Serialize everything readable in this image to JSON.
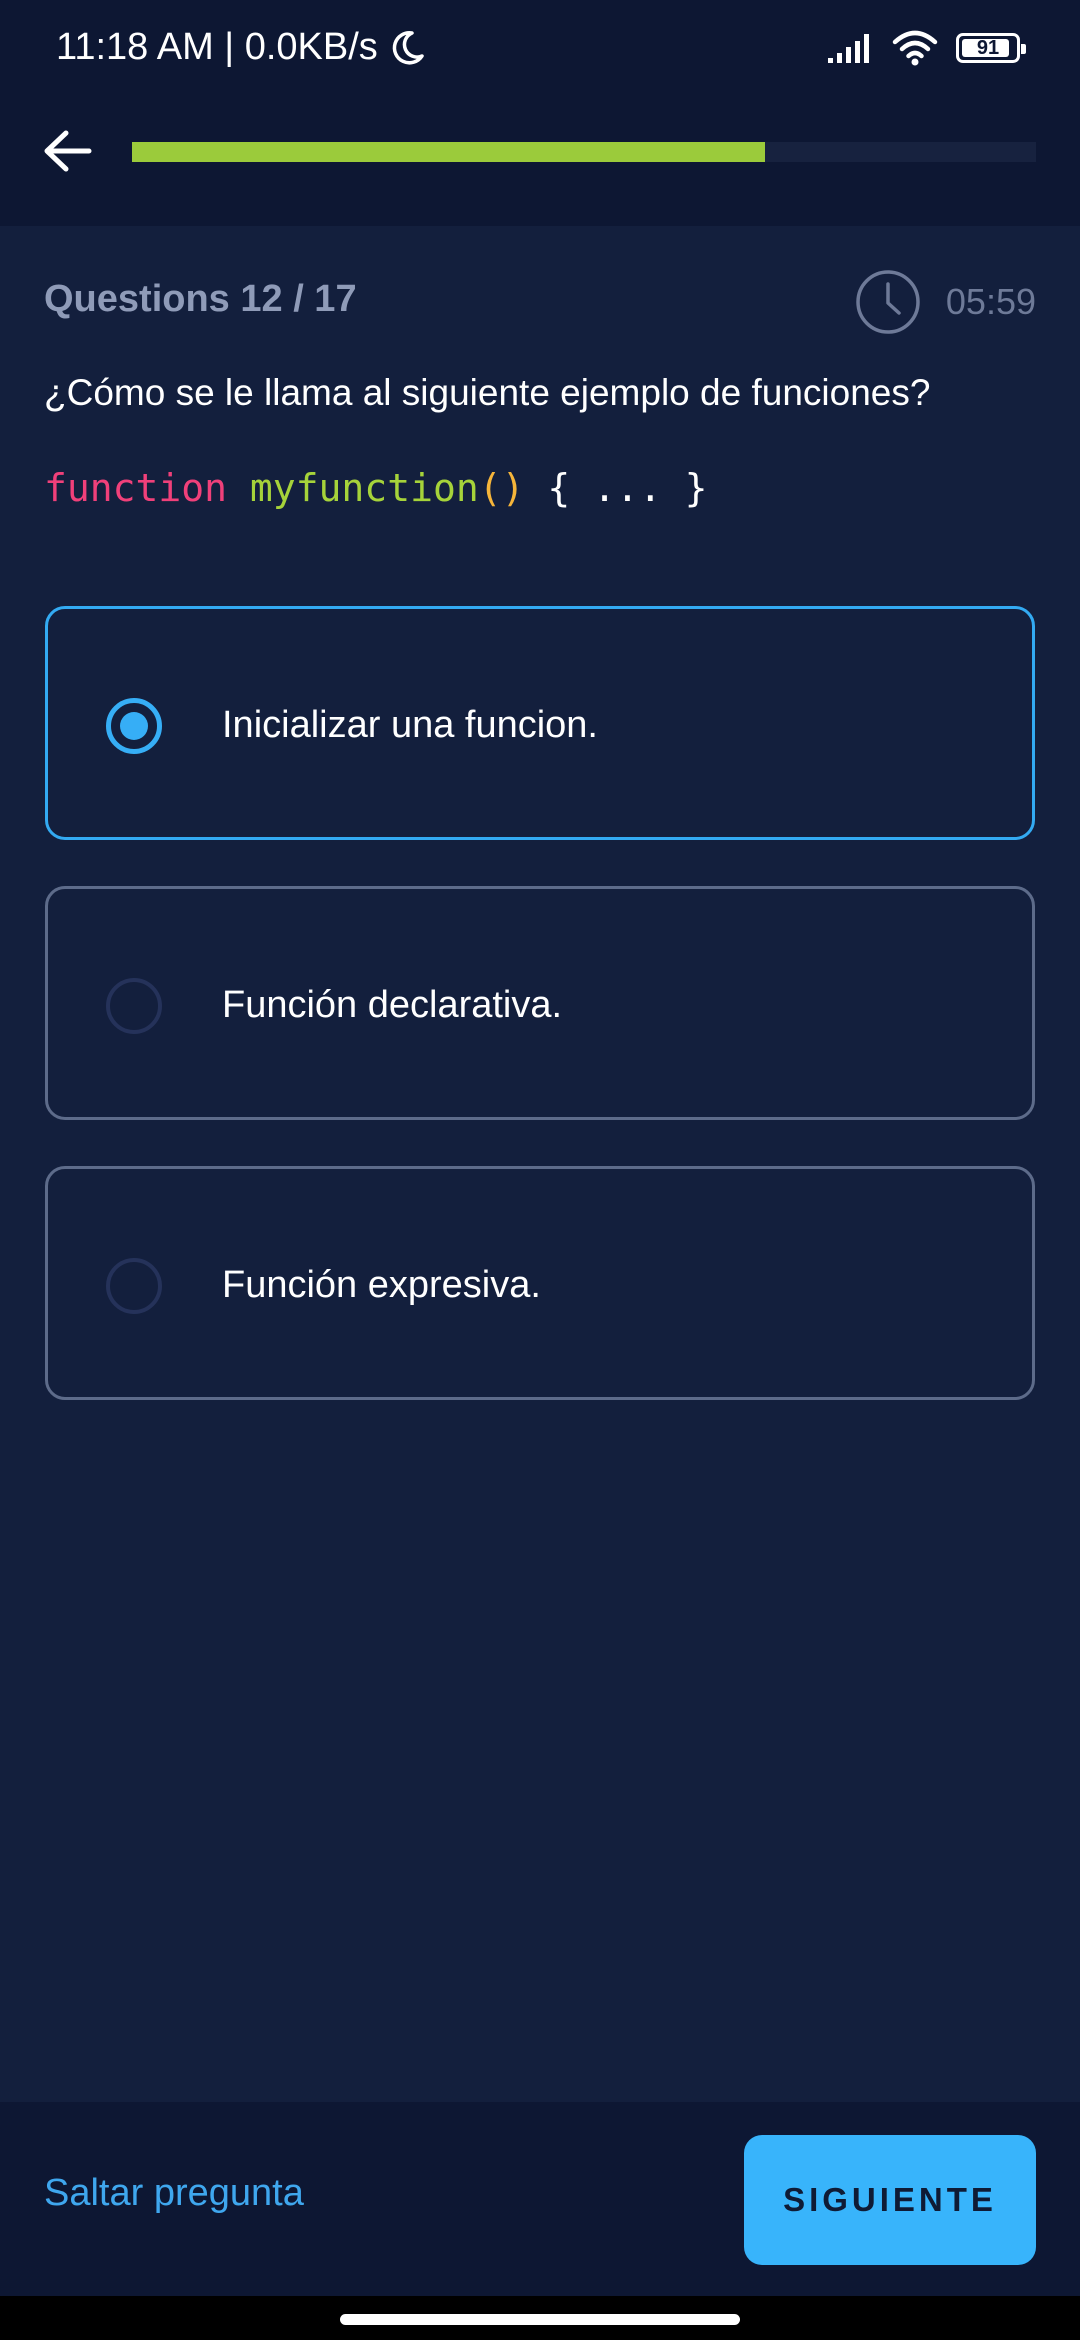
{
  "status_bar": {
    "time_network": "11:18 AM | 0.0KB/s",
    "battery_level": "91",
    "battery_fraction": 0.91
  },
  "header": {
    "progress_fraction": 0.7
  },
  "quiz": {
    "counter": "Questions 12 / 17",
    "timer": "05:59",
    "question": "¿Cómo se le llama al siguiente ejemplo de funciones?",
    "code": {
      "keyword": "function",
      "name": "myfunction",
      "parens": "()",
      "body": "{ ... }"
    },
    "options": [
      {
        "label": "Inicializar una funcion.",
        "selected": true
      },
      {
        "label": "Función declarativa.",
        "selected": false
      },
      {
        "label": "Función expresiva.",
        "selected": false
      }
    ]
  },
  "footer": {
    "skip_label": "Saltar pregunta",
    "next_label": "SIGUIENTE"
  },
  "colors": {
    "background": "#131f3d",
    "header_background": "#0d1733",
    "progress": "#9bcb3b",
    "accent": "#36aef6",
    "code_keyword": "#f0407a",
    "code_name": "#a6d33a",
    "code_parens": "#f6b53a",
    "code_body": "#ffffff"
  },
  "icons": {
    "back": "arrow-left-icon",
    "timer": "clock-icon",
    "moon": "moon-icon",
    "signal": "signal-icon",
    "wifi": "wifi-icon",
    "battery": "battery-icon"
  }
}
